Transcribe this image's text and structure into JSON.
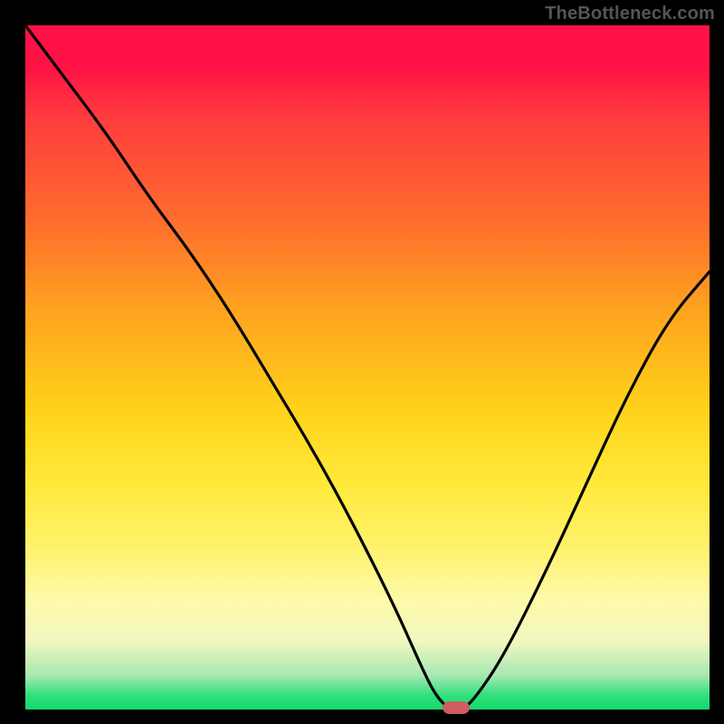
{
  "watermark": "TheBottleneck.com",
  "chart_data": {
    "type": "line",
    "title": "",
    "xlabel": "",
    "ylabel": "",
    "xlim": [
      0,
      100
    ],
    "ylim": [
      0,
      100
    ],
    "grid": false,
    "legend": false,
    "annotations": [],
    "background_gradient_stops": [
      {
        "pos": 0,
        "color": "#ff1245"
      },
      {
        "pos": 28,
        "color": "#ff6b2e"
      },
      {
        "pos": 56,
        "color": "#ffd21a"
      },
      {
        "pos": 84,
        "color": "#fdfaa9"
      },
      {
        "pos": 100,
        "color": "#16d86c"
      }
    ],
    "series": [
      {
        "name": "bottleneck-curve",
        "x": [
          0,
          6,
          12,
          18,
          24,
          30,
          36,
          42,
          48,
          54,
          58,
          60,
          62,
          63,
          64,
          66,
          70,
          76,
          82,
          88,
          94,
          100
        ],
        "y": [
          100,
          92,
          84,
          75,
          67,
          58,
          48,
          38,
          27,
          15,
          6,
          2,
          0,
          0,
          0,
          2,
          8,
          20,
          33,
          46,
          57,
          64
        ]
      }
    ],
    "optimal_marker": {
      "x": 63,
      "y": 0,
      "color": "#d25a61"
    }
  }
}
